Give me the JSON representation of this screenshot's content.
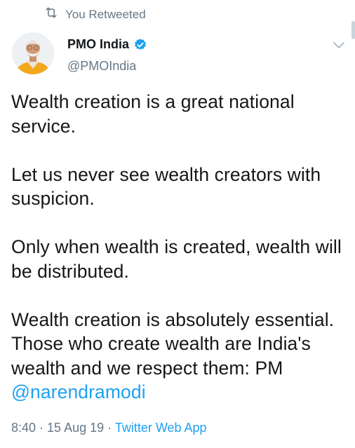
{
  "retweet": {
    "icon": "retweet-icon",
    "label": "You Retweeted"
  },
  "author": {
    "name": "PMO India",
    "handle": "@PMOIndia",
    "verified_icon": "verified-badge-icon",
    "avatar_icon": "avatar-portrait"
  },
  "menu": {
    "icon": "chevron-down-icon"
  },
  "tweet": {
    "text_main": "Wealth creation is a great national service.\n\nLet us never see wealth creators with suspicion.\n\nOnly when wealth is created, wealth will be distributed.\n\nWealth creation is absolutely essential. Those who create wealth are India's wealth and we respect them: PM ",
    "mention": "@narendramodi"
  },
  "meta": {
    "time": "8:40",
    "separator1": " · ",
    "date": "15 Aug 19",
    "separator2": " · ",
    "source": "Twitter Web App"
  },
  "colors": {
    "accent": "#1da1f2",
    "secondary_text": "#657786",
    "primary_text": "#14171a"
  }
}
